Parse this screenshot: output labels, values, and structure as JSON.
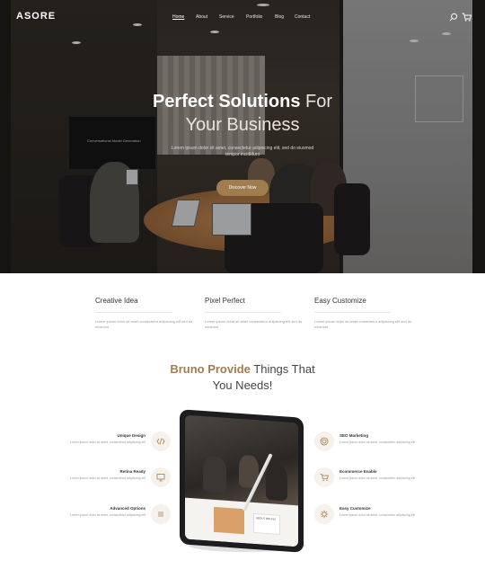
{
  "nav": {
    "logo": "ASORE",
    "items": [
      "Home",
      "About",
      "Service",
      "Portfolio",
      "Blog",
      "Contact"
    ],
    "active_index": 0,
    "icons": [
      "search-icon",
      "cart-icon"
    ]
  },
  "hero": {
    "title_bold": "Perfect Solutions",
    "title_light": " For",
    "title_line2": "Your Business",
    "subtitle": "Lorem ipsum dolor sit amet, consectetur adipiscing elit, sed do eiusmod tempor incididunt",
    "button": "Discover Now",
    "tv_caption": "Conversational Model Generation"
  },
  "features": [
    {
      "title": "Creative Idea",
      "text": "Lorem ipsum dolor sit amet consectetur adipiscing elit sed do eiusmod"
    },
    {
      "title": "Pixel Perfect",
      "text": "Lorem ipsum dolor sit amet consectetur adipiscing elit sed do eiusmod"
    },
    {
      "title": "Easy Customize",
      "text": "Lorem ipsum dolor sit amet consectetur adipiscing elit sed do eiusmod"
    }
  ],
  "provide": {
    "brand": "Bruno Provide",
    "rest": " Things That",
    "line2": "You Needs!"
  },
  "services_left": [
    {
      "title": "Unique Design",
      "text": "Lorem ipsum dolor sit amet, consectetur adipiscing elit",
      "icon": "code-icon"
    },
    {
      "title": "Retina Ready",
      "text": "Lorem ipsum dolor sit amet, consectetur adipiscing elit",
      "icon": "monitor-icon"
    },
    {
      "title": "Advanced Options",
      "text": "Lorem ipsum dolor sit amet, consectetur adipiscing elit",
      "icon": "list-icon"
    }
  ],
  "services_right": [
    {
      "title": "SEO Marketing",
      "text": "Lorem ipsum dolor sit amet, consectetur adipiscing elit",
      "icon": "target-icon"
    },
    {
      "title": "Ecommerce Enable",
      "text": "Lorem ipsum dolor sit amet, consectetur adipiscing elit",
      "icon": "cart-icon"
    },
    {
      "title": "Easy Customize",
      "text": "Lorem ipsum dolor sit amet, consectetur adipiscing elit",
      "icon": "gear-icon"
    }
  ],
  "tablet": {
    "card_text": "ABOUT BRUNO"
  },
  "colors": {
    "accent": "#a07d4f",
    "text": "#333333",
    "muted": "#999999"
  }
}
